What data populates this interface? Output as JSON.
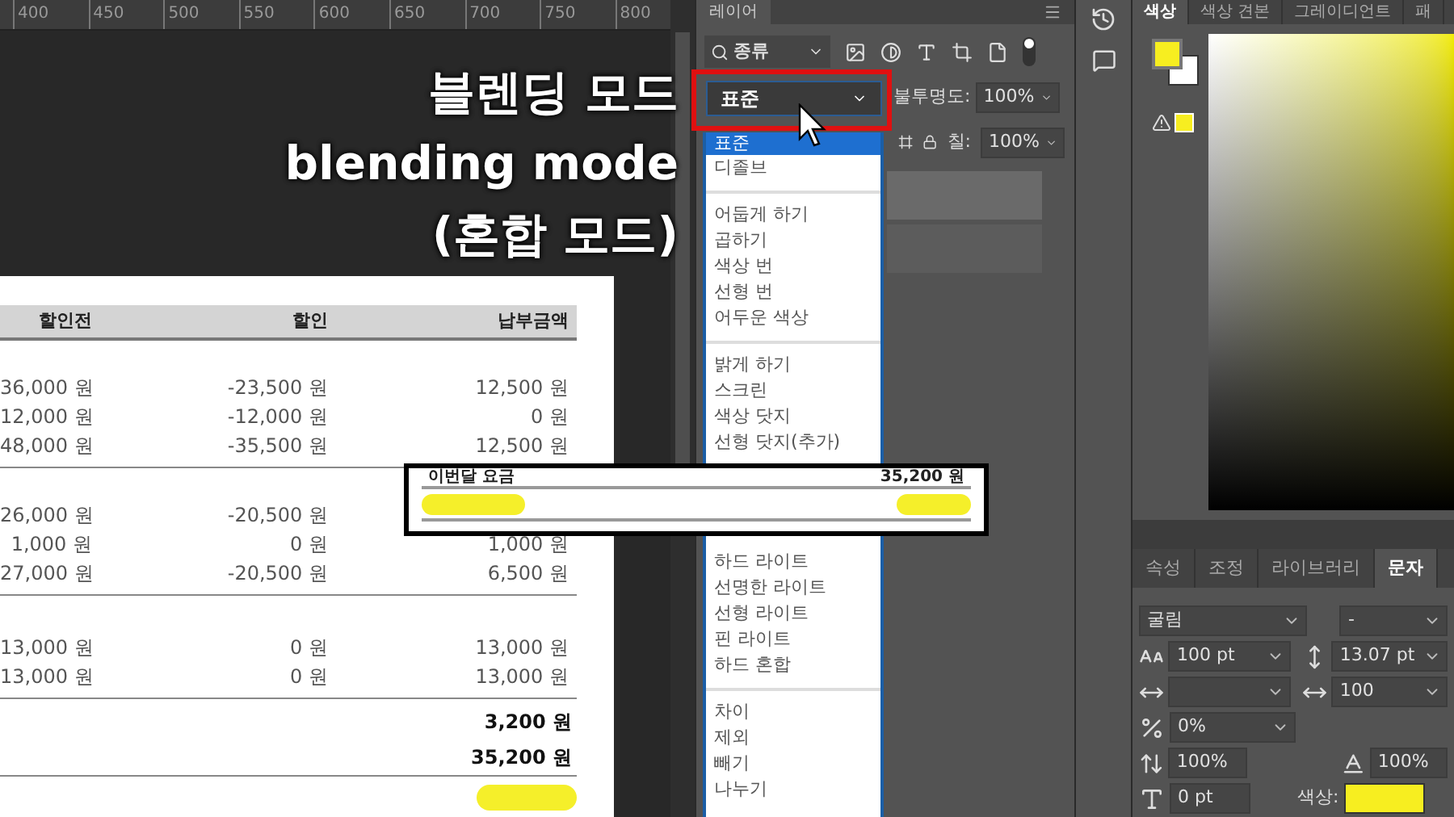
{
  "canvas": {
    "ruler_marks": [
      "400",
      "450",
      "500",
      "550",
      "600",
      "650",
      "700",
      "750",
      "800"
    ],
    "caption_lines": [
      "블렌딩 모드",
      "blending mode",
      "(혼합 모드)"
    ],
    "document": {
      "columns": [
        "할인전",
        "할인",
        "납부금액"
      ],
      "groups": [
        {
          "rows": [
            {
              "before": "36,000 원",
              "discount": "-23,500 원",
              "amount": "12,500 원"
            },
            {
              "before": "12,000 원",
              "discount": "-12,000 원",
              "amount": "0 원"
            },
            {
              "before": "48,000 원",
              "discount": "-35,500 원",
              "amount": "12,500 원"
            }
          ]
        },
        {
          "rows": [
            {
              "before": "26,000 원",
              "discount": "-20,500 원"
            },
            {
              "before": "1,000 원",
              "discount": "0 원",
              "amount": "1,000 원"
            },
            {
              "before": "27,000 원",
              "discount": "-20,500 원",
              "amount": "6,500 원"
            }
          ]
        },
        {
          "rows": [
            {
              "before": "13,000 원",
              "discount": "0 원",
              "amount": "13,000 원"
            },
            {
              "before": "13,000 원",
              "discount": "0 원",
              "amount": "13,000 원"
            }
          ]
        }
      ],
      "totals": [
        "3,200 원",
        "35,200 원"
      ]
    },
    "zoom_inset": {
      "label": "이번달 요금",
      "amount": "35,200 원"
    }
  },
  "layers_panel": {
    "tab": "레이어",
    "filter": "종류",
    "blend_mode": "표준",
    "opacity_label": "불투명도:",
    "opacity": "100%",
    "fill_label": "칠:",
    "fill": "100%",
    "blend_menu": [
      [
        {
          "label": "표준",
          "selected": true
        },
        {
          "label": "디졸브",
          "selected": false
        }
      ],
      [
        {
          "label": "어둡게 하기",
          "selected": false
        },
        {
          "label": "곱하기",
          "selected": false
        },
        {
          "label": "색상 번",
          "selected": false
        },
        {
          "label": "선형 번",
          "selected": false
        },
        {
          "label": "어두운 색상",
          "selected": false
        }
      ],
      [
        {
          "label": "밝게 하기",
          "selected": false
        },
        {
          "label": "스크린",
          "selected": false
        },
        {
          "label": "색상 닷지",
          "selected": false
        },
        {
          "label": "선형 닷지(추가)",
          "selected": false
        }
      ],
      [
        {
          "label": "하드 라이트",
          "selected": false
        },
        {
          "label": "선명한 라이트",
          "selected": false
        },
        {
          "label": "선형 라이트",
          "selected": false
        },
        {
          "label": "핀 라이트",
          "selected": false
        },
        {
          "label": "하드 혼합",
          "selected": false
        }
      ],
      [
        {
          "label": "차이",
          "selected": false
        },
        {
          "label": "제외",
          "selected": false
        },
        {
          "label": "빼기",
          "selected": false
        },
        {
          "label": "나누기",
          "selected": false
        }
      ]
    ]
  },
  "color_panel": {
    "tabs": [
      {
        "label": "색상",
        "selected": true
      },
      {
        "label": "색상 견본",
        "selected": false
      },
      {
        "label": "그레이디언트",
        "selected": false
      },
      {
        "label": "패",
        "selected": false
      }
    ]
  },
  "character_panel": {
    "tabs": [
      {
        "label": "속성",
        "selected": false
      },
      {
        "label": "조정",
        "selected": false
      },
      {
        "label": "라이브러리",
        "selected": false
      },
      {
        "label": "문자",
        "selected": true
      }
    ],
    "font": "굴림",
    "style": "-",
    "size": "100 pt",
    "leading": "13.07 pt",
    "tracking": "100",
    "tsume": "0%",
    "vertical_scale": "100%",
    "horizontal_scale": "100%",
    "baseline_shift": "0 pt",
    "color_label": "색상:"
  }
}
